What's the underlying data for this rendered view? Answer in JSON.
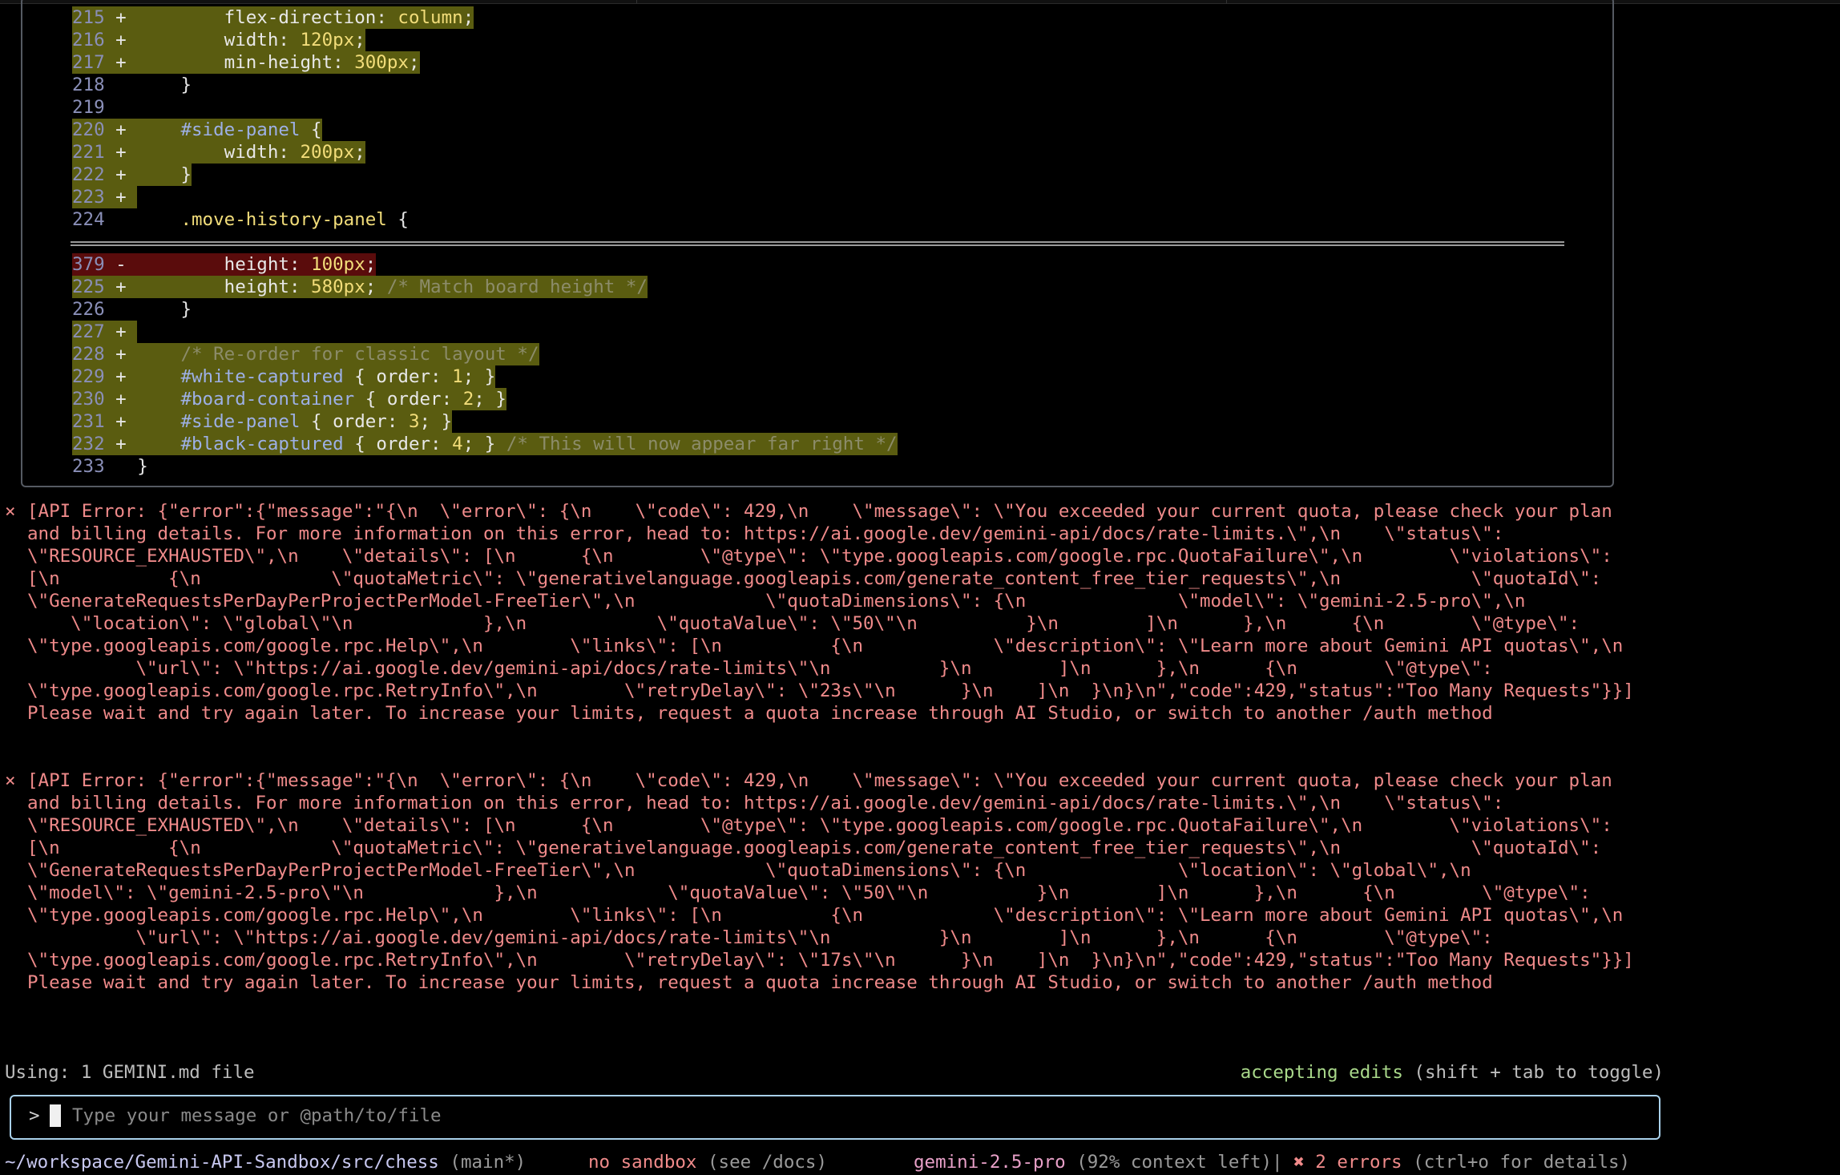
{
  "diff": {
    "lines": [
      {
        "num": "215",
        "sign": "+",
        "type": "add",
        "indent": "        ",
        "parts": [
          [
            "kw",
            "flex-direction"
          ],
          [
            "plain",
            ": "
          ],
          [
            "val",
            "column"
          ],
          [
            "plain",
            ";"
          ]
        ]
      },
      {
        "num": "216",
        "sign": "+",
        "type": "add",
        "indent": "        ",
        "parts": [
          [
            "kw",
            "width"
          ],
          [
            "plain",
            ": "
          ],
          [
            "val",
            "120px"
          ],
          [
            "plain",
            ";"
          ]
        ]
      },
      {
        "num": "217",
        "sign": "+",
        "type": "add",
        "indent": "        ",
        "parts": [
          [
            "kw",
            "min-height"
          ],
          [
            "plain",
            ": "
          ],
          [
            "val",
            "300px"
          ],
          [
            "plain",
            ";"
          ]
        ]
      },
      {
        "num": "218",
        "sign": " ",
        "type": "ctx",
        "indent": "    ",
        "parts": [
          [
            "plain",
            "}"
          ]
        ]
      },
      {
        "num": "219",
        "sign": " ",
        "type": "ctx",
        "indent": "",
        "parts": []
      },
      {
        "num": "220",
        "sign": "+",
        "type": "add",
        "indent": "    ",
        "parts": [
          [
            "sel",
            "#side-panel"
          ],
          [
            "plain",
            " {"
          ]
        ]
      },
      {
        "num": "221",
        "sign": "+",
        "type": "add",
        "indent": "        ",
        "parts": [
          [
            "kw",
            "width"
          ],
          [
            "plain",
            ": "
          ],
          [
            "val",
            "200px"
          ],
          [
            "plain",
            ";"
          ]
        ]
      },
      {
        "num": "222",
        "sign": "+",
        "type": "add",
        "indent": "    ",
        "parts": [
          [
            "plain",
            "}"
          ]
        ]
      },
      {
        "num": "223",
        "sign": "+",
        "type": "add",
        "indent": "",
        "parts": []
      },
      {
        "num": "224",
        "sign": " ",
        "type": "ctx",
        "indent": "    ",
        "parts": [
          [
            "val",
            ".move-history-panel"
          ],
          [
            "plain",
            " {"
          ]
        ]
      },
      {
        "num": "379",
        "sign": "-",
        "type": "del",
        "indent": "        ",
        "parts": [
          [
            "kw",
            "height"
          ],
          [
            "plain",
            ": "
          ],
          [
            "val",
            "100px"
          ],
          [
            "plain",
            ";"
          ]
        ]
      },
      {
        "num": "225",
        "sign": "+",
        "type": "add",
        "indent": "        ",
        "parts": [
          [
            "kw",
            "height"
          ],
          [
            "plain",
            ": "
          ],
          [
            "val",
            "580px"
          ],
          [
            "plain",
            "; "
          ],
          [
            "cm",
            "/* Match board height */"
          ]
        ]
      },
      {
        "num": "226",
        "sign": " ",
        "type": "ctx",
        "indent": "    ",
        "parts": [
          [
            "plain",
            "}"
          ]
        ]
      },
      {
        "num": "227",
        "sign": "+",
        "type": "add",
        "indent": "",
        "parts": []
      },
      {
        "num": "228",
        "sign": "+",
        "type": "add",
        "indent": "    ",
        "parts": [
          [
            "cm",
            "/* Re-order for classic layout */"
          ]
        ]
      },
      {
        "num": "229",
        "sign": "+",
        "type": "add",
        "indent": "    ",
        "parts": [
          [
            "sel",
            "#white-captured"
          ],
          [
            "plain",
            " { "
          ],
          [
            "kw",
            "order"
          ],
          [
            "plain",
            ": "
          ],
          [
            "val",
            "1"
          ],
          [
            "plain",
            "; }"
          ]
        ]
      },
      {
        "num": "230",
        "sign": "+",
        "type": "add",
        "indent": "    ",
        "parts": [
          [
            "sel",
            "#board-container"
          ],
          [
            "plain",
            " { "
          ],
          [
            "kw",
            "order"
          ],
          [
            "plain",
            ": "
          ],
          [
            "val",
            "2"
          ],
          [
            "plain",
            "; }"
          ]
        ]
      },
      {
        "num": "231",
        "sign": "+",
        "type": "add",
        "indent": "    ",
        "parts": [
          [
            "sel",
            "#side-panel"
          ],
          [
            "plain",
            " { "
          ],
          [
            "kw",
            "order"
          ],
          [
            "plain",
            ": "
          ],
          [
            "val",
            "3"
          ],
          [
            "plain",
            "; }"
          ]
        ]
      },
      {
        "num": "232",
        "sign": "+",
        "type": "add",
        "indent": "    ",
        "parts": [
          [
            "sel",
            "#black-captured"
          ],
          [
            "plain",
            " { "
          ],
          [
            "kw",
            "order"
          ],
          [
            "plain",
            ": "
          ],
          [
            "val",
            "4"
          ],
          [
            "plain",
            "; } "
          ],
          [
            "cm",
            "/* This will now appear far right */"
          ]
        ]
      },
      {
        "num": "233",
        "sign": " ",
        "type": "ctx",
        "indent": "",
        "parts": [
          [
            "plain",
            "}"
          ]
        ]
      }
    ]
  },
  "errors": [
    {
      "icon": "×",
      "lines": [
        "[API Error: {\"error\":{\"message\":\"{\\n  \\\"error\\\": {\\n    \\\"code\\\": 429,\\n    \\\"message\\\": \\\"You exceeded your current quota, please check your plan",
        "and billing details. For more information on this error, head to: https://ai.google.dev/gemini-api/docs/rate-limits.\\\",\\n    \\\"status\\\":",
        "\\\"RESOURCE_EXHAUSTED\\\",\\n    \\\"details\\\": [\\n      {\\n        \\\"@type\\\": \\\"type.googleapis.com/google.rpc.QuotaFailure\\\",\\n        \\\"violations\\\":",
        "[\\n          {\\n            \\\"quotaMetric\\\": \\\"generativelanguage.googleapis.com/generate_content_free_tier_requests\\\",\\n            \\\"quotaId\\\":",
        "\\\"GenerateRequestsPerDayPerProjectPerModel-FreeTier\\\",\\n            \\\"quotaDimensions\\\": {\\n              \\\"model\\\": \\\"gemini-2.5-pro\\\",\\n",
        "    \\\"location\\\": \\\"global\\\"\\n            },\\n            \\\"quotaValue\\\": \\\"50\\\"\\n          }\\n        ]\\n      },\\n      {\\n        \\\"@type\\\":",
        "\\\"type.googleapis.com/google.rpc.Help\\\",\\n        \\\"links\\\": [\\n          {\\n            \\\"description\\\": \\\"Learn more about Gemini API quotas\\\",\\n",
        "          \\\"url\\\": \\\"https://ai.google.dev/gemini-api/docs/rate-limits\\\"\\n          }\\n        ]\\n      },\\n      {\\n        \\\"@type\\\":",
        "\\\"type.googleapis.com/google.rpc.RetryInfo\\\",\\n        \\\"retryDelay\\\": \\\"23s\\\"\\n      }\\n    ]\\n  }\\n}\\n\",\"code\":429,\"status\":\"Too Many Requests\"}}]",
        "Please wait and try again later. To increase your limits, request a quota increase through AI Studio, or switch to another /auth method"
      ]
    },
    {
      "icon": "×",
      "lines": [
        "[API Error: {\"error\":{\"message\":\"{\\n  \\\"error\\\": {\\n    \\\"code\\\": 429,\\n    \\\"message\\\": \\\"You exceeded your current quota, please check your plan",
        "and billing details. For more information on this error, head to: https://ai.google.dev/gemini-api/docs/rate-limits.\\\",\\n    \\\"status\\\":",
        "\\\"RESOURCE_EXHAUSTED\\\",\\n    \\\"details\\\": [\\n      {\\n        \\\"@type\\\": \\\"type.googleapis.com/google.rpc.QuotaFailure\\\",\\n        \\\"violations\\\":",
        "[\\n          {\\n            \\\"quotaMetric\\\": \\\"generativelanguage.googleapis.com/generate_content_free_tier_requests\\\",\\n            \\\"quotaId\\\":",
        "\\\"GenerateRequestsPerDayPerProjectPerModel-FreeTier\\\",\\n            \\\"quotaDimensions\\\": {\\n              \\\"location\\\": \\\"global\\\",\\n",
        "\\\"model\\\": \\\"gemini-2.5-pro\\\"\\n            },\\n            \\\"quotaValue\\\": \\\"50\\\"\\n          }\\n        ]\\n      },\\n      {\\n        \\\"@type\\\":",
        "\\\"type.googleapis.com/google.rpc.Help\\\",\\n        \\\"links\\\": [\\n          {\\n            \\\"description\\\": \\\"Learn more about Gemini API quotas\\\",\\n",
        "          \\\"url\\\": \\\"https://ai.google.dev/gemini-api/docs/rate-limits\\\"\\n          }\\n        ]\\n      },\\n      {\\n        \\\"@type\\\":",
        "\\\"type.googleapis.com/google.rpc.RetryInfo\\\",\\n        \\\"retryDelay\\\": \\\"17s\\\"\\n      }\\n    ]\\n  }\\n}\\n\",\"code\":429,\"status\":\"Too Many Requests\"}}]",
        "Please wait and try again later. To increase your limits, request a quota increase through AI Studio, or switch to another /auth method"
      ]
    }
  ],
  "status": {
    "using": "Using: 1 GEMINI.md file",
    "accepting": "accepting edits",
    "toggle_hint": " (shift + tab to toggle)"
  },
  "input": {
    "prompt": ">",
    "placeholder": "Type your message or @path/to/file"
  },
  "footer": {
    "path": "~/workspace/Gemini-API-Sandbox/src/chess",
    "branch": " (main*)",
    "sandbox": "no sandbox",
    "sandbox_hint": " (see /docs)",
    "model": "gemini-2.5-pro",
    "context": " (92% context left)",
    "sep": "| ",
    "errors": "✖ 2 errors",
    "errors_hint": " (ctrl+o for details)"
  },
  "colors": {
    "add_bg": "#5a5c10",
    "del_bg": "#5a0c0c",
    "error_text": "#ef8a8a",
    "accent_green": "#a9d88a",
    "input_border": "#a9d0ea"
  }
}
